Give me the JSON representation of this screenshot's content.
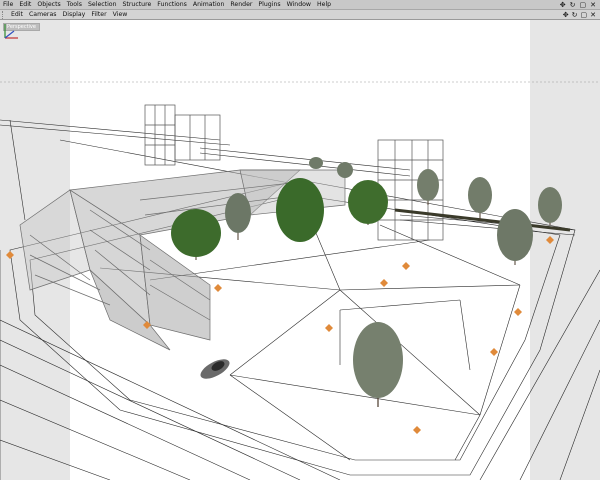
{
  "menu": {
    "items": [
      "File",
      "Edit",
      "Objects",
      "Tools",
      "Selection",
      "Structure",
      "Functions",
      "Animation",
      "Render",
      "Plugins",
      "Window",
      "Help"
    ],
    "window_controls": [
      "✥",
      "↻",
      "▢",
      "✕"
    ]
  },
  "viewport_menu": {
    "items": [
      "Edit",
      "Cameras",
      "Display",
      "Filter",
      "View"
    ],
    "controls": [
      "✥",
      "↻",
      "▢",
      "✕"
    ]
  },
  "viewport": {
    "label": "Perspective",
    "colors": {
      "background": "#ffffff",
      "side_shade": "#e6e6e6",
      "wire": "#2a2a2a",
      "building": "#6e6e6e",
      "tree": "#3d6b2c",
      "lamp": "#e08a3a"
    }
  }
}
